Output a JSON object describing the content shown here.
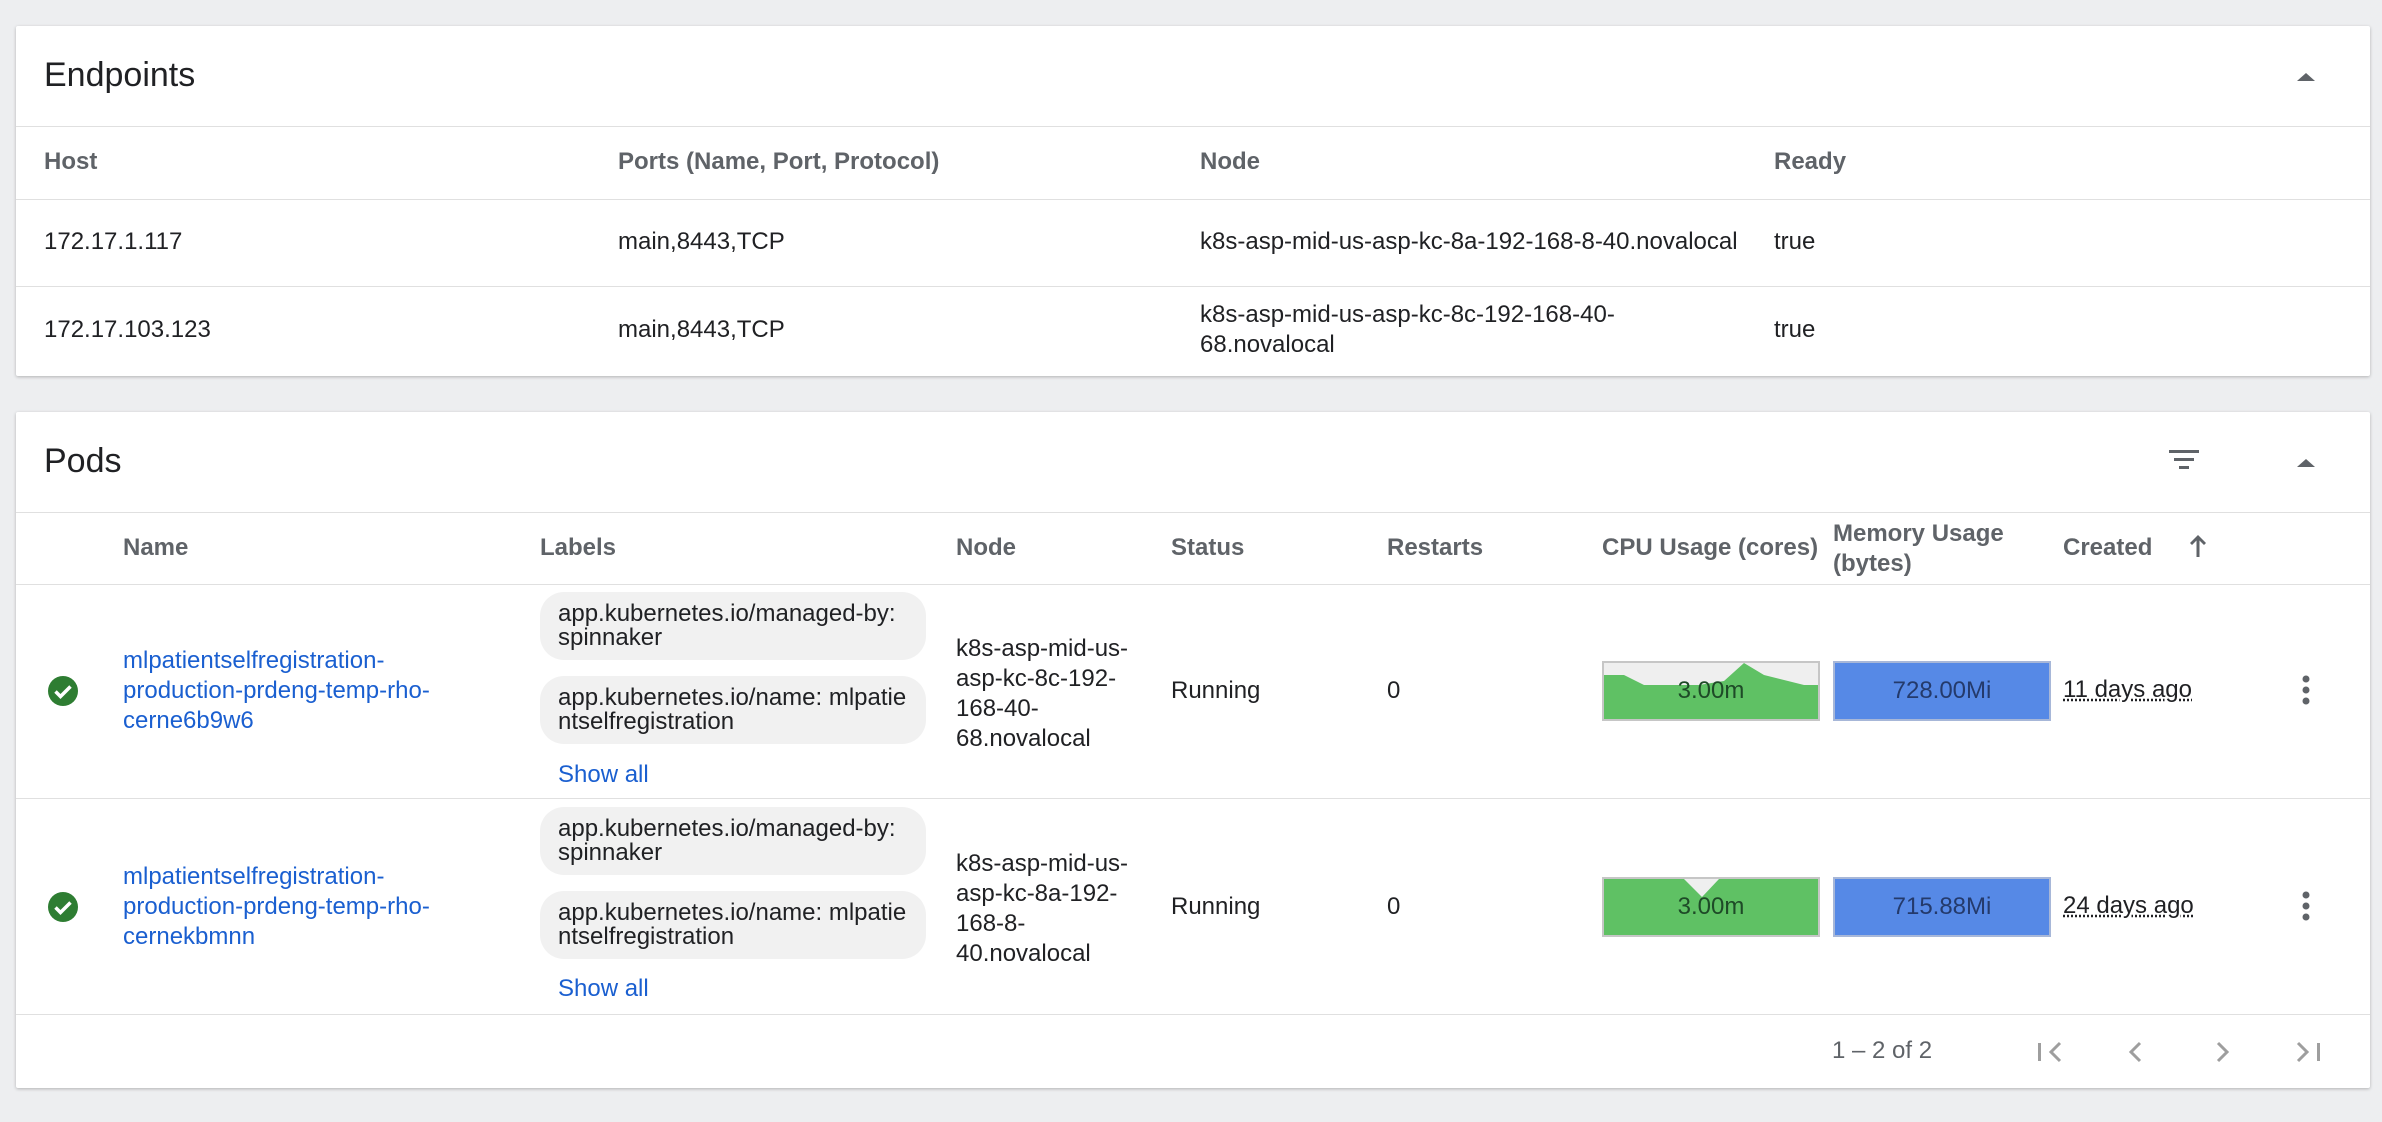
{
  "endpoints": {
    "title": "Endpoints",
    "columns": [
      "Host",
      "Ports (Name, Port, Protocol)",
      "Node",
      "Ready"
    ],
    "rows": [
      {
        "host": "172.17.1.117",
        "ports": "main,8443,TCP",
        "node": "k8s-asp-mid-us-asp-kc-8a-192-168-8-40.novalocal",
        "ready": "true"
      },
      {
        "host": "172.17.103.123",
        "ports": "main,8443,TCP",
        "node_line1": "k8s-asp-mid-us-asp-kc-8c-192-168-40-",
        "node_line2": "68.novalocal",
        "ready": "true"
      }
    ]
  },
  "pods": {
    "title": "Pods",
    "columns": {
      "name": "Name",
      "labels": "Labels",
      "node": "Node",
      "status": "Status",
      "restarts": "Restarts",
      "cpu": "CPU Usage (cores)",
      "memory_line1": "Memory Usage",
      "memory_line2": "(bytes)",
      "created": "Created"
    },
    "rows": [
      {
        "name_lines": [
          "mlpatientselfregistration-",
          "production-prdeng-temp-rho-",
          "cerne6b9w6"
        ],
        "labels": [
          "app.kubernetes.io/managed-by: spinnaker",
          "app.kubernetes.io/name: mlpatientselfregistration"
        ],
        "show_all": "Show all",
        "node_lines": [
          "k8s-asp-mid-us-",
          "asp-kc-8c-192-",
          "168-40-",
          "68.novalocal"
        ],
        "status": "Running",
        "restarts": "0",
        "cpu": "3.00m",
        "memory": "728.00Mi",
        "created": "11 days ago"
      },
      {
        "name_lines": [
          "mlpatientselfregistration-",
          "production-prdeng-temp-rho-",
          "cernekbmnn"
        ],
        "labels": [
          "app.kubernetes.io/managed-by: spinnaker",
          "app.kubernetes.io/name: mlpatientselfregistration"
        ],
        "show_all": "Show all",
        "node_lines": [
          "k8s-asp-mid-us-",
          "asp-kc-8a-192-",
          "168-8-",
          "40.novalocal"
        ],
        "status": "Running",
        "restarts": "0",
        "cpu": "3.00m",
        "memory": "715.88Mi",
        "created": "24 days ago"
      }
    ],
    "pagination": "1 – 2 of 2"
  },
  "icons": {
    "collapse": "chevron-up-icon",
    "filter": "filter-icon",
    "status_ok": "check-circle-icon",
    "sort": "arrow-up-icon",
    "menu": "more-vert-icon",
    "first": "first-page-icon",
    "prev": "chevron-left-icon",
    "next": "chevron-right-icon",
    "last": "last-page-icon"
  },
  "colors": {
    "link": "#1a5fd0",
    "ok": "#2e7d32",
    "cpu_fill": "#5fc164",
    "mem_fill": "#5689e6"
  }
}
